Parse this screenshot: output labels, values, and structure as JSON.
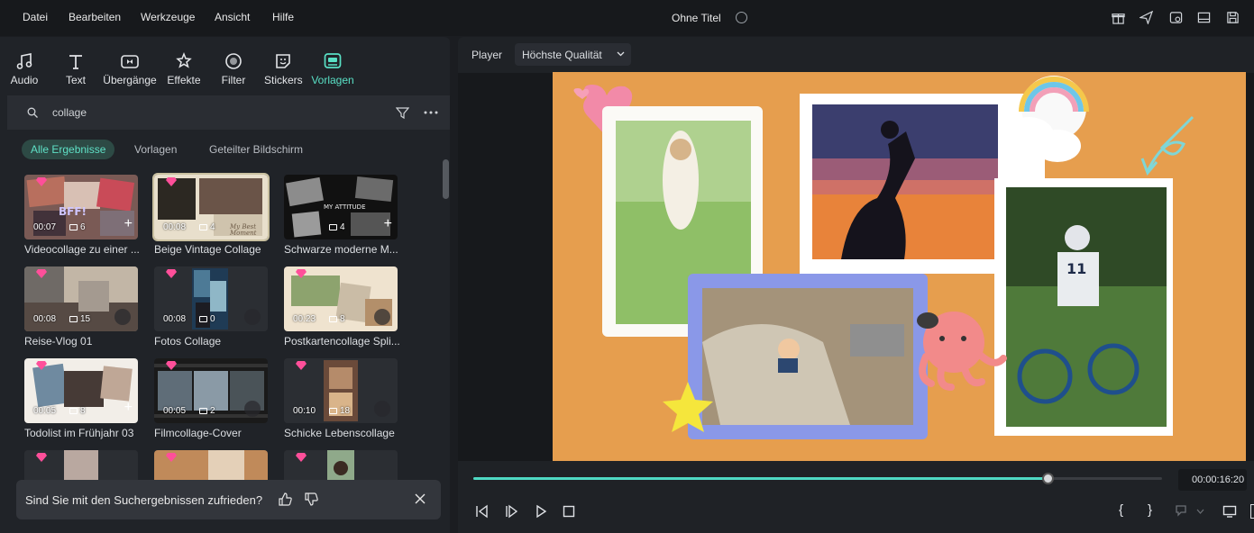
{
  "menu": {
    "items": [
      "Datei",
      "Bearbeiten",
      "Werkzeuge",
      "Ansicht",
      "Hilfe"
    ],
    "title": "Ohne Titel"
  },
  "categories": [
    {
      "label": "Audio",
      "icon": "music-note-icon",
      "active": false
    },
    {
      "label": "Text",
      "icon": "text-icon",
      "active": false
    },
    {
      "label": "Übergänge",
      "icon": "transitions-icon",
      "active": false
    },
    {
      "label": "Effekte",
      "icon": "effects-icon",
      "active": false
    },
    {
      "label": "Filter",
      "icon": "filter-icon",
      "active": false
    },
    {
      "label": "Stickers",
      "icon": "sticker-icon",
      "active": false
    },
    {
      "label": "Vorlagen",
      "icon": "templates-icon",
      "active": true
    }
  ],
  "search": {
    "value": "collage"
  },
  "chips": [
    "Alle Ergebnisse",
    "Vorlagen",
    "Geteilter Bildschirm"
  ],
  "cards": [
    {
      "name": "Videocollage zu einer ...",
      "duration": "00:07",
      "count": "6",
      "action": "plus"
    },
    {
      "name": "Beige Vintage Collage",
      "duration": "00:08",
      "count": "4",
      "action": "none"
    },
    {
      "name": "Schwarze moderne M...",
      "duration": "",
      "count": "4",
      "action": "plus"
    },
    {
      "name": "Reise-Vlog 01",
      "duration": "00:08",
      "count": "15",
      "action": "download"
    },
    {
      "name": "Fotos Collage",
      "duration": "00:08",
      "count": "0",
      "action": "download"
    },
    {
      "name": "Postkartencollage Spli...",
      "duration": "00:23",
      "count": "8",
      "action": "download"
    },
    {
      "name": "Todolist im Frühjahr 03",
      "duration": "00:05",
      "count": "8",
      "action": "plus"
    },
    {
      "name": "Filmcollage-Cover",
      "duration": "00:05",
      "count": "2",
      "action": "download"
    },
    {
      "name": "Schicke Lebenscollage",
      "duration": "00:10",
      "count": "18",
      "action": "download"
    }
  ],
  "toast": {
    "text": "Sind Sie mit den Suchergebnissen zufrieden?"
  },
  "player": {
    "label": "Player",
    "quality": "Höchste Qualität",
    "timecode": "00:00:16:20",
    "progress": 0.835
  },
  "colors": {
    "accent": "#4fd9c3",
    "canvas": "#e69e4e",
    "premium": "#ff4f9a"
  }
}
